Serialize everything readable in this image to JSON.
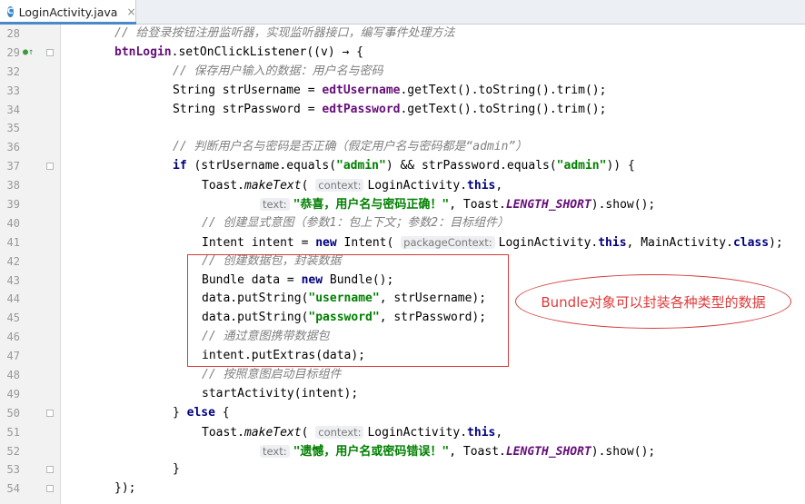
{
  "tab": {
    "icon": "C",
    "title": "LoginActivity.java",
    "close": "×"
  },
  "gutter": {
    "marker_line": "29"
  },
  "lines": [
    {
      "n": "28",
      "indent": 0,
      "fold": false,
      "parts": [
        [
          "cm",
          "// 给登录按钮注册监听器，实现监听器接口，编写事件处理方法"
        ]
      ]
    },
    {
      "n": "29",
      "indent": 0,
      "fold": true,
      "marker": "●↑",
      "parts": [
        [
          "fld",
          "btnLogin"
        ],
        [
          "",
          "."
        ],
        [
          "",
          "setOnClickListener((v) → {"
        ]
      ]
    },
    {
      "n": "32",
      "indent": 2,
      "fold": false,
      "parts": [
        [
          "cm",
          "// 保存用户输入的数据：用户名与密码"
        ]
      ]
    },
    {
      "n": "33",
      "indent": 2,
      "fold": false,
      "parts": [
        [
          "",
          "String strUsername = "
        ],
        [
          "fld",
          "edtUsername"
        ],
        [
          "",
          ".getText().toString().trim();"
        ]
      ]
    },
    {
      "n": "34",
      "indent": 2,
      "fold": false,
      "parts": [
        [
          "",
          "String strPassword = "
        ],
        [
          "fld",
          "edtPassword"
        ],
        [
          "",
          ".getText().toString().trim();"
        ]
      ]
    },
    {
      "n": "35",
      "indent": 0,
      "fold": false,
      "parts": []
    },
    {
      "n": "36",
      "indent": 2,
      "fold": false,
      "parts": [
        [
          "cm",
          "// 判断用户名与密码是否正确（假定用户名与密码都是“admin”）"
        ]
      ]
    },
    {
      "n": "37",
      "indent": 2,
      "fold": true,
      "parts": [
        [
          "kw",
          "if"
        ],
        [
          "",
          " (strUsername.equals("
        ],
        [
          "str",
          "\"admin\""
        ],
        [
          "",
          ") && strPassword.equals("
        ],
        [
          "str",
          "\"admin\""
        ],
        [
          "",
          ")) {"
        ]
      ]
    },
    {
      "n": "38",
      "indent": 3,
      "fold": false,
      "parts": [
        [
          "",
          "Toast."
        ],
        [
          "it",
          "makeText"
        ],
        [
          "",
          "( "
        ],
        [
          "hint",
          "context:"
        ],
        [
          "",
          "LoginActivity."
        ],
        [
          "kw",
          "this"
        ],
        [
          "",
          ","
        ]
      ]
    },
    {
      "n": "39",
      "indent": 5,
      "fold": false,
      "parts": [
        [
          "hint",
          "text:"
        ],
        [
          "str",
          "\"恭喜，用户名与密码正确！\""
        ],
        [
          "",
          ", Toast."
        ],
        [
          "fldi",
          "LENGTH_SHORT"
        ],
        [
          "",
          ").show();"
        ]
      ]
    },
    {
      "n": "40",
      "indent": 3,
      "fold": false,
      "parts": [
        [
          "cm",
          "// 创建显式意图（参数1：包上下文；参数2：目标组件）"
        ]
      ]
    },
    {
      "n": "41",
      "indent": 3,
      "fold": false,
      "parts": [
        [
          "",
          "Intent intent = "
        ],
        [
          "kw",
          "new"
        ],
        [
          "",
          " Intent( "
        ],
        [
          "hint",
          "packageContext:"
        ],
        [
          "",
          "LoginActivity."
        ],
        [
          "kw",
          "this"
        ],
        [
          "",
          ", MainActivity."
        ],
        [
          "kw",
          "class"
        ],
        [
          "",
          ");"
        ]
      ]
    },
    {
      "n": "42",
      "indent": 3,
      "fold": false,
      "parts": [
        [
          "cm",
          "// 创建数据包，封装数据"
        ]
      ]
    },
    {
      "n": "43",
      "indent": 3,
      "fold": false,
      "parts": [
        [
          "",
          "Bundle data = "
        ],
        [
          "kw",
          "new"
        ],
        [
          "",
          " Bundle();"
        ]
      ]
    },
    {
      "n": "44",
      "indent": 3,
      "fold": false,
      "parts": [
        [
          "",
          "data.putString("
        ],
        [
          "str",
          "\"username\""
        ],
        [
          "",
          ", strUsername);"
        ]
      ]
    },
    {
      "n": "45",
      "indent": 3,
      "fold": false,
      "parts": [
        [
          "",
          "data.putString("
        ],
        [
          "str",
          "\"password\""
        ],
        [
          "",
          ", strPassword);"
        ]
      ]
    },
    {
      "n": "46",
      "indent": 3,
      "fold": false,
      "parts": [
        [
          "cm",
          "// 通过意图携带数据包"
        ]
      ]
    },
    {
      "n": "47",
      "indent": 3,
      "fold": false,
      "parts": [
        [
          "",
          "intent.putExtras(data);"
        ]
      ]
    },
    {
      "n": "48",
      "indent": 3,
      "fold": false,
      "parts": [
        [
          "cm",
          "// 按照意图启动目标组件"
        ]
      ]
    },
    {
      "n": "49",
      "indent": 3,
      "fold": false,
      "parts": [
        [
          "",
          "startActivity(intent);"
        ]
      ]
    },
    {
      "n": "50",
      "indent": 2,
      "fold": true,
      "parts": [
        [
          "",
          "} "
        ],
        [
          "kw",
          "else"
        ],
        [
          "",
          " {"
        ]
      ]
    },
    {
      "n": "51",
      "indent": 3,
      "fold": false,
      "parts": [
        [
          "",
          "Toast."
        ],
        [
          "it",
          "makeText"
        ],
        [
          "",
          "( "
        ],
        [
          "hint",
          "context:"
        ],
        [
          "",
          "LoginActivity."
        ],
        [
          "kw",
          "this"
        ],
        [
          "",
          ","
        ]
      ]
    },
    {
      "n": "52",
      "indent": 5,
      "fold": false,
      "parts": [
        [
          "hint",
          "text:"
        ],
        [
          "str",
          "\"遗憾，用户名或密码错误！\""
        ],
        [
          "",
          ", Toast."
        ],
        [
          "fldi",
          "LENGTH_SHORT"
        ],
        [
          "",
          ").show();"
        ]
      ]
    },
    {
      "n": "53",
      "indent": 2,
      "fold": true,
      "parts": [
        [
          "",
          "}"
        ]
      ]
    },
    {
      "n": "54",
      "indent": 0,
      "fold": true,
      "parts": [
        [
          "",
          "});"
        ]
      ]
    }
  ],
  "annotation": {
    "text": "Bundle对象可以封装各种类型的数据",
    "color": "#e03a3a"
  },
  "colors": {
    "keyword": "#000080",
    "comment": "#808080",
    "string": "#008000",
    "field": "#660e7a"
  }
}
